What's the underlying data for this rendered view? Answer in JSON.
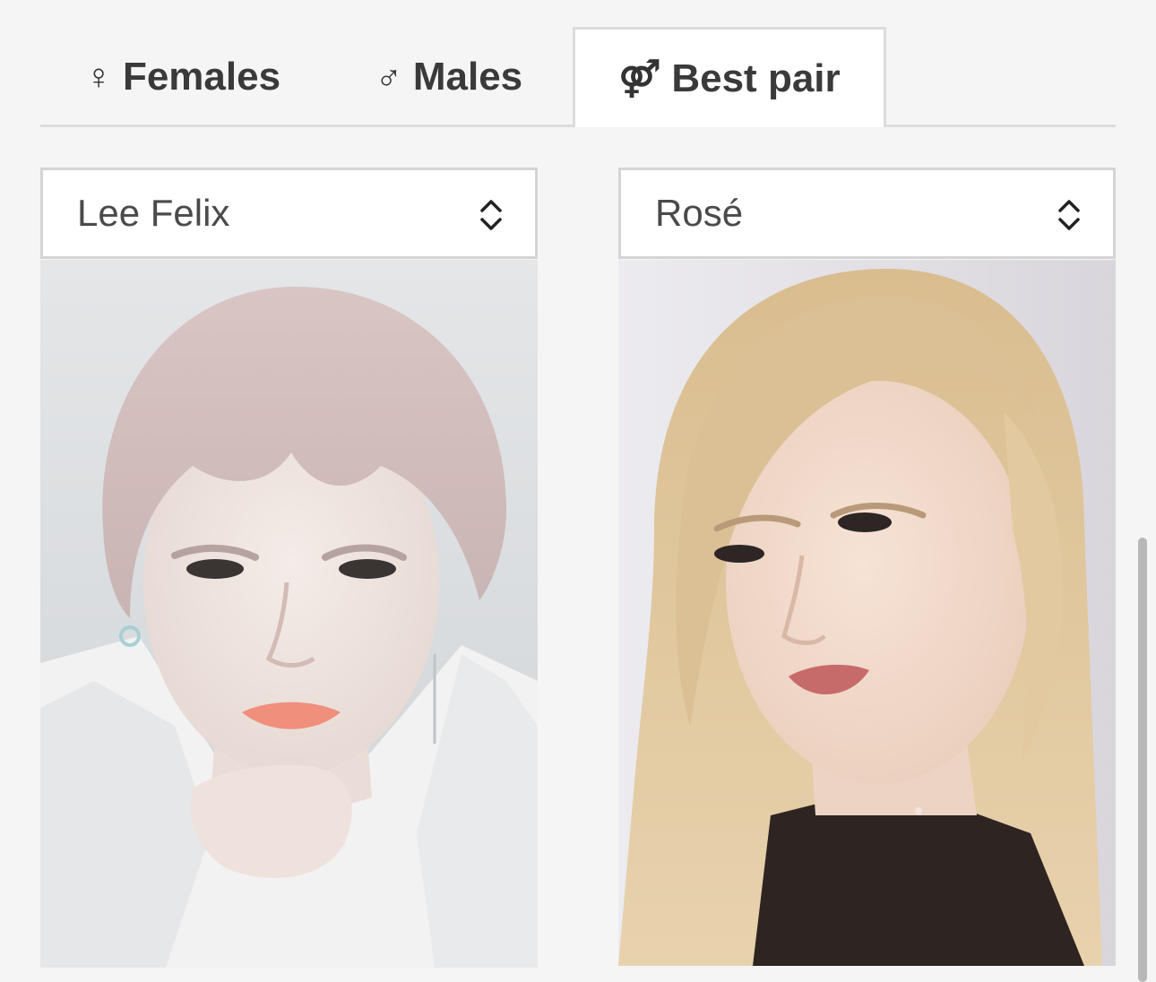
{
  "tabs": [
    {
      "icon": "female-icon",
      "glyph": "♀",
      "label": "Females",
      "active": false
    },
    {
      "icon": "male-icon",
      "glyph": "♂",
      "label": "Males",
      "active": false
    },
    {
      "icon": "pair-icon",
      "glyph": "⚤",
      "label": "Best pair",
      "active": true
    }
  ],
  "left_select": {
    "value": "Lee Felix",
    "icon": "chevron-up-down-icon"
  },
  "right_select": {
    "value": "Rosé",
    "icon": "chevron-up-down-icon"
  },
  "left_photo": {
    "name": "Lee Felix"
  },
  "right_photo": {
    "name": "Rosé"
  }
}
